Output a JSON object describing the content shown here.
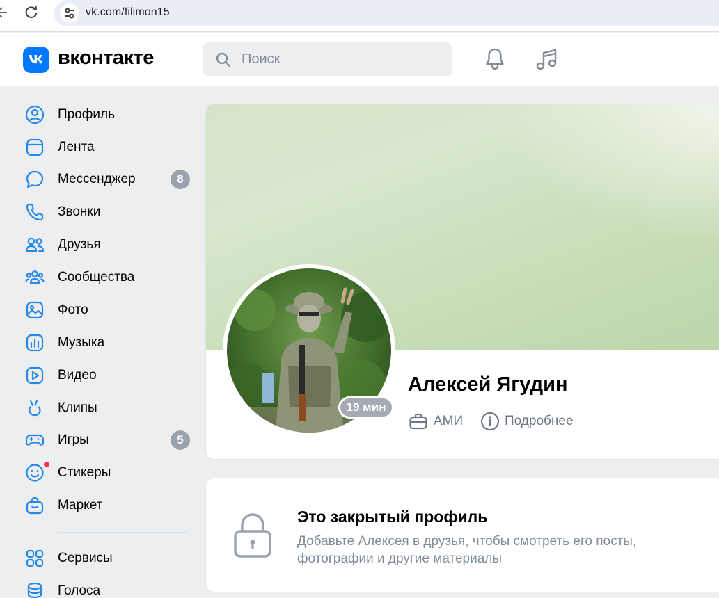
{
  "browser": {
    "url": "vk.com/filimon15"
  },
  "header": {
    "logo_text": "вконтакте",
    "search_placeholder": "Поиск"
  },
  "sidebar": {
    "items": [
      {
        "label": "Профиль",
        "icon": "profile-icon"
      },
      {
        "label": "Лента",
        "icon": "feed-icon"
      },
      {
        "label": "Мессенджер",
        "icon": "messenger-icon",
        "badge": "8"
      },
      {
        "label": "Звонки",
        "icon": "phone-icon"
      },
      {
        "label": "Друзья",
        "icon": "friends-icon"
      },
      {
        "label": "Сообщества",
        "icon": "communities-icon"
      },
      {
        "label": "Фото",
        "icon": "photo-icon"
      },
      {
        "label": "Музыка",
        "icon": "music-chart-icon"
      },
      {
        "label": "Видео",
        "icon": "video-icon"
      },
      {
        "label": "Клипы",
        "icon": "clips-icon"
      },
      {
        "label": "Игры",
        "icon": "gamepad-icon",
        "badge": "5"
      },
      {
        "label": "Стикеры",
        "icon": "smile-icon",
        "dot": true
      },
      {
        "label": "Маркет",
        "icon": "market-bag-icon"
      },
      {
        "label": "Сервисы",
        "icon": "services-grid-icon"
      },
      {
        "label": "Голоса",
        "icon": "coins-icon"
      }
    ]
  },
  "profile": {
    "name": "Алексей Ягудин",
    "online_status": "19 мин",
    "work": "АМИ",
    "details_label": "Подробнее"
  },
  "closed_profile": {
    "title": "Это закрытый профиль",
    "text": "Добавьте Алексея в друзья, чтобы смотреть его посты, фотографии и другие материалы"
  },
  "colors": {
    "accent": "#0077ff",
    "icon_blue": "#2688eb",
    "badge_gray": "#99a2ad",
    "secondary_text": "#6d7885"
  }
}
